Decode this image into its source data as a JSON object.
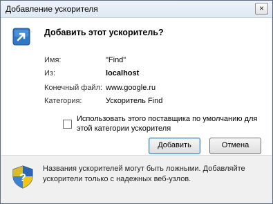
{
  "window": {
    "title": "Добавление ускорителя",
    "close_label": "×"
  },
  "dialog": {
    "heading": "Добавить этот ускоритель?",
    "fields": [
      {
        "label": "Имя:",
        "value": "\"Find\"",
        "bold": false
      },
      {
        "label": "Из:",
        "value": "localhost",
        "bold": true
      },
      {
        "label": "Конечный файл:",
        "value": "www.google.ru",
        "bold": false
      },
      {
        "label": "Категория:",
        "value": "Ускоритель Find",
        "bold": false
      }
    ],
    "default_checkbox": {
      "label": "Использовать этого поставщика по умолчанию для этой категории ускорителя",
      "checked": false
    },
    "buttons": {
      "add": "Добавить",
      "cancel": "Отмена"
    }
  },
  "footer": {
    "warning": "Названия ускорителей могут быть ложными. Добавляйте ускорители только с надежных веб-узлов."
  },
  "icons": {
    "add": "add-accelerator-icon",
    "shield": "security-shield-icon"
  },
  "colors": {
    "icon_blue": "#2f78c4",
    "shield_blue": "#2a66b3"
  }
}
